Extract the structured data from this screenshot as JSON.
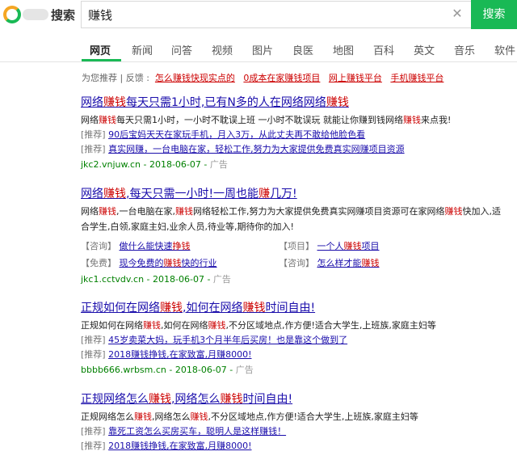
{
  "header": {
    "logo_text": "搜索",
    "search_value": "赚钱",
    "clear_glyph": "✕",
    "search_button": "搜索",
    "accent_color": "#19b955"
  },
  "nav": {
    "tabs": [
      "网页",
      "新闻",
      "问答",
      "视频",
      "图片",
      "良医",
      "地图",
      "百科",
      "英文",
      "音乐",
      "软件"
    ],
    "active": "网页"
  },
  "suggest": {
    "label": "为您推荐",
    "separator": " | ",
    "feedback": "反馈 :",
    "items": [
      "怎么赚钱快现实点的",
      "0成本在家赚钱项目",
      "网上赚钱平台",
      "手机赚钱平台"
    ]
  },
  "results": [
    {
      "title_parts": [
        "网络",
        "赚钱",
        "每天只需1小时,已有N多的人在网络网络",
        "赚钱"
      ],
      "desc_parts": [
        "网络",
        "赚钱",
        "每天只需1小时，一小时不耽误上班 一小时不耽误玩 就能让你赚到钱网络",
        "赚钱",
        "来点我!"
      ],
      "subs": [
        {
          "tag": "[推荐]",
          "text": "90后宝妈天天在家玩手机，月入3万，从此丈夫再不敢给他脸色看"
        },
        {
          "tag": "[推荐]",
          "text": "真实网赚，一台电脑在家，轻松工作,努力为大家提供免费真实网赚项目资源"
        }
      ],
      "url": "jkc2.vnjuw.cn",
      "date": "2018-06-07",
      "ad": "广告"
    },
    {
      "title_parts": [
        "网络",
        "赚钱",
        ",每天只需一小时!一周也能",
        "赚",
        "几万!"
      ],
      "desc_parts": [
        "网络",
        "赚钱",
        ",一台电脑在家,",
        "赚钱",
        "网络轻松工作,努力为大家提供免费真实网赚项目资源可在家网络",
        "赚钱",
        "快加入,适合学生,白领,家庭主妇,业余人员,待业等,期待你的加入!"
      ],
      "grid": [
        {
          "tag": "【咨询】",
          "pre": "做什么能快速",
          "hl": "挣钱",
          "post": ""
        },
        {
          "tag": "【项目】",
          "pre": "一个人",
          "hl": "赚钱",
          "post": "项目"
        },
        {
          "tag": "【免费】",
          "pre": "现今免费的",
          "hl": "赚钱",
          "post": "快的行业"
        },
        {
          "tag": "【咨询】",
          "pre": "怎么样才能",
          "hl": "赚钱",
          "post": ""
        }
      ],
      "url": "jkc1.cctvdv.cn",
      "date": "2018-06-07",
      "ad": "广告"
    },
    {
      "title_parts": [
        "正规如何在网络",
        "赚钱",
        ",如何在网络",
        "赚钱",
        "时间自由!"
      ],
      "desc_parts": [
        "正规如何在网络",
        "赚钱",
        ",如何在网络",
        "赚钱",
        ",不分区域地点,作方便!适合大学生,上班族,家庭主妇等"
      ],
      "subs": [
        {
          "tag": "[推荐]",
          "text": "45岁卖菜大妈，玩手机3个月半年后买房！也是靠这个做到了"
        },
        {
          "tag": "[推荐]",
          "text": "2018赚钱挣钱,在家致富,月赚8000!"
        }
      ],
      "url": "bbbb666.wrbsm.cn",
      "date": "2018-06-07",
      "ad": "广告"
    },
    {
      "title_parts": [
        "正规网络怎么",
        "赚钱",
        ",网络怎么",
        "赚钱",
        "时间自由!"
      ],
      "desc_parts": [
        "正规网络怎么",
        "赚钱",
        ",网络怎么",
        "赚钱",
        ",不分区域地点,作方便!适合大学生,上班族,家庭主妇等"
      ],
      "subs": [
        {
          "tag": "[推荐]",
          "text": "靠死工资怎么买房买车，聪明人是这样赚钱！"
        },
        {
          "tag": "[推荐]",
          "text": "2018赚钱挣钱,在家致富,月赚8000!"
        }
      ],
      "url": "",
      "date": "",
      "ad": ""
    }
  ]
}
